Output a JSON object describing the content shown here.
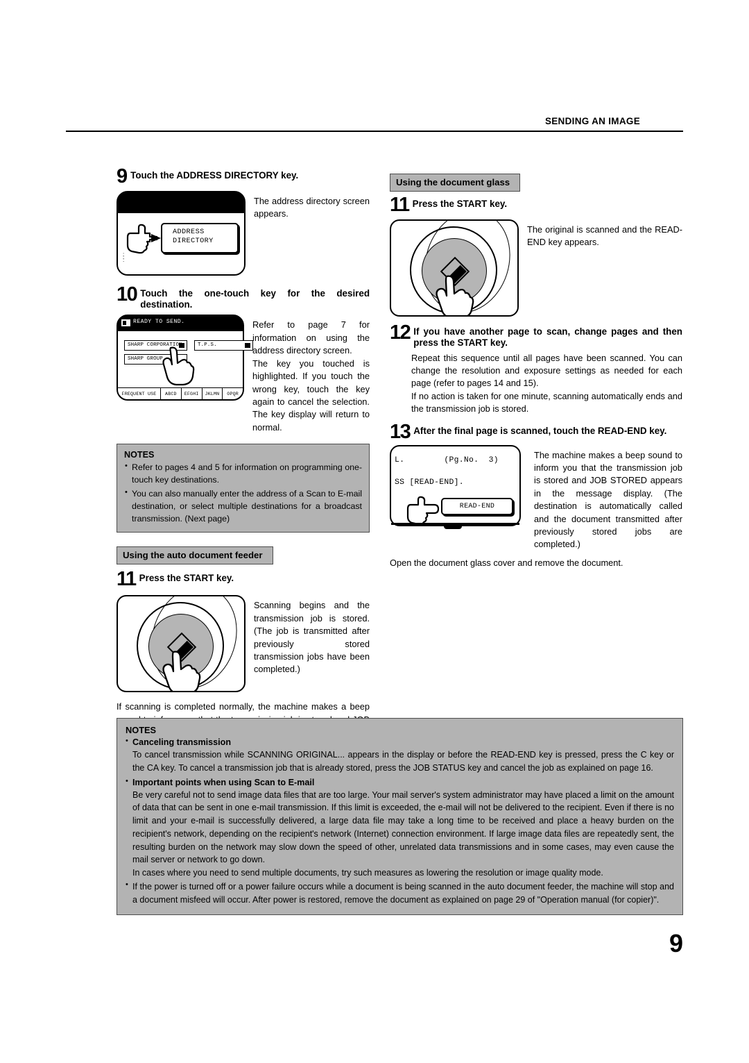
{
  "header": {
    "running_title": "SENDING AN IMAGE"
  },
  "page_number": "9",
  "left_column": {
    "step9": {
      "number": "9",
      "title": "Touch the ADDRESS DIRECTORY key.",
      "side_text": "The address directory screen appears.",
      "lcd": {
        "key_line1": "ADDRESS",
        "key_line2": "DIRECTORY"
      }
    },
    "step10": {
      "number": "10",
      "title": "Touch the one-touch key for the desired destination.",
      "side_text_1": "Refer to page 7 for information on using the address directory screen.",
      "side_text_2": "The key you touched is highlighted. If you touch the wrong key, touch the key again to cancel the selection. The key display will return to normal.",
      "lcd": {
        "status": "READY  TO SEND.",
        "key1": "SHARP CORPORATION",
        "key2": "T.P.S.",
        "key3": "SHARP GROUP",
        "tabs": [
          "FREQUENT USE",
          "ABCD",
          "EFGHI",
          "JKLMN",
          "OPQR"
        ]
      }
    },
    "notes": {
      "title": "NOTES",
      "items": [
        "Refer to pages 4 and 5 for information on programming one-touch key destinations.",
        "You can also manually enter the address of a Scan to E-mail destination, or select multiple destinations for a broadcast transmission. (Next page)"
      ]
    },
    "section_adf": "Using the auto document feeder",
    "step11": {
      "number": "11",
      "title": "Press the START key.",
      "side_text": "Scanning begins and the transmission job is stored. (The job is transmitted after previously stored transmission jobs have been completed.)",
      "after_text": "If scanning is completed normally, the machine makes a beep sound to inform you that the transmission job is stored and JOB STORED appears in the message display."
    }
  },
  "right_column": {
    "section_glass": "Using the document glass",
    "step11": {
      "number": "11",
      "title": "Press the START key.",
      "side_text": "The original is scanned and the READ-END key appears."
    },
    "step12": {
      "number": "12",
      "title": "If you have another page to scan, change pages and then press the START key.",
      "body_1": "Repeat this sequence until all pages have been scanned. You can change the resolution and exposure settings as needed for each page (refer to pages 14 and 15).",
      "body_2": "If no action is taken for one minute, scanning automatically ends and the transmission job is stored."
    },
    "step13": {
      "number": "13",
      "title": "After the final page is scanned, touch the READ-END key.",
      "side_text": "The machine makes a beep sound to inform you that the transmission job is stored and JOB STORED appears in the message display. (The destination is automatically called and the document transmitted after previously stored jobs are completed.)",
      "after_text": "Open the document glass cover and remove the document.",
      "lcd": {
        "line1": "L.        (Pg.No.  3)",
        "line2": "SS [READ-END].",
        "key": "READ-END"
      }
    }
  },
  "bottom_notes": {
    "title": "NOTES",
    "item1_heading": "Canceling transmission",
    "item1_body": "To cancel transmission while SCANNING ORIGINAL... appears in the display or before the READ-END key is pressed, press the C key or the CA key. To cancel a transmission job that is already stored, press the JOB STATUS key and cancel the job as explained on page 16.",
    "item2_heading": "Important points when using Scan to E-mail",
    "item2_body": "Be very careful not to send image data files that are too large. Your mail server's system administrator may have placed a limit on the amount of data that can be sent in one e-mail transmission. If this limit is exceeded, the e-mail will not be delivered to the recipient. Even if there is no limit and your e-mail is successfully delivered, a large data file may take a long time to be received and place a heavy burden on the recipient's network, depending on the recipient's network (Internet) connection environment. If large image data files are repeatedly sent, the resulting burden on the network may slow down the speed of other, unrelated data transmissions and in some cases, may even cause the mail server or network to go down.",
    "item2_body2": "In cases where you need to send multiple documents, try such measures as lowering the resolution or image quality mode.",
    "item3_body": "If the power is turned off or a power failure occurs while a document is being scanned in the auto document feeder, the machine will stop and a document misfeed will occur. After power is restored, remove the document as explained on page 29 of \"Operation manual (for copier)\"."
  },
  "colors": {
    "gray_panel": "#b3b3b3",
    "panel_border": "#4d4d4d",
    "button_gray": "#b5b5b5"
  }
}
